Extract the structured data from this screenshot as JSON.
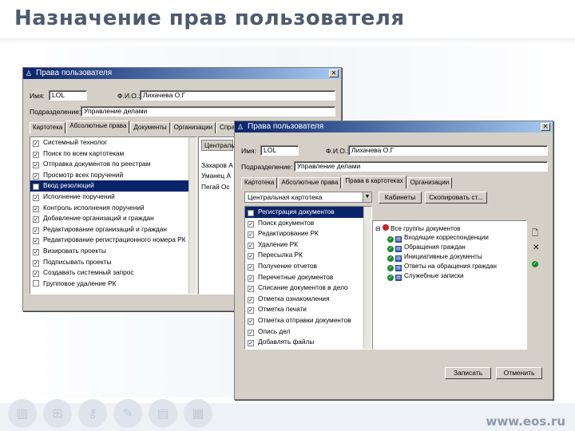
{
  "slide": {
    "title": "Назначение прав пользователя",
    "url": "www.eos.ru",
    "bottom_icons": [
      "folder-icon",
      "network-icon",
      "key-icon",
      "pen-icon",
      "clipboard-icon",
      "document-icon"
    ]
  },
  "back_window": {
    "title": "Права пользователя",
    "name_label": "Имя:",
    "name_value": "LOL",
    "fio_label": "Ф.И.О.:",
    "fio_value": "Лихачева О.Г",
    "dept_label": "Подразделение:",
    "dept_value": "Управление делами",
    "tabs": [
      "Картотека",
      "Абсолютные права",
      "Документы",
      "Организации",
      "Справочники"
    ],
    "permissions": [
      {
        "label": "Системный технолог",
        "checked": true,
        "selected": false
      },
      {
        "label": "Поиск по всем картотекам",
        "checked": true,
        "selected": false
      },
      {
        "label": "Отправка документов по реестрам",
        "checked": true,
        "selected": false
      },
      {
        "label": "Просмотр всех поручений",
        "checked": true,
        "selected": false
      },
      {
        "label": "Ввод резолюций",
        "checked": true,
        "selected": true
      },
      {
        "label": "Исполнение поручений",
        "checked": true,
        "selected": false
      },
      {
        "label": "Контроль исполнения поручений",
        "checked": true,
        "selected": false
      },
      {
        "label": "Добавление организаций и граждан",
        "checked": true,
        "selected": false
      },
      {
        "label": "Редактирование организаций и граждан",
        "checked": true,
        "selected": false
      },
      {
        "label": "Редактирование регистрационного номера РК",
        "checked": true,
        "selected": false
      },
      {
        "label": "Визировать проекты",
        "checked": true,
        "selected": false
      },
      {
        "label": "Подписывать проекты",
        "checked": true,
        "selected": false
      },
      {
        "label": "Создавать системный запрос",
        "checked": true,
        "selected": false
      },
      {
        "label": "Групповое удаление РК",
        "checked": false,
        "selected": false
      }
    ],
    "side_list_header": "Центральная",
    "side_list_items": [
      "Захаров А",
      "Уманец А",
      "Пегай Ос"
    ]
  },
  "front_window": {
    "title": "Права пользователя",
    "name_label": "Имя:",
    "name_value": "LOL",
    "fio_label": "Ф.И.О.:",
    "fio_value": "Лихачева О.Г",
    "dept_label": "Подразделение:",
    "dept_value": "Управление делами",
    "tabs": [
      "Картотека",
      "Абсолютные права",
      "Права в картотеках",
      "Организации"
    ],
    "cabinet_combo": "Центральная картотека",
    "btn_cabinets": "Кабинеты",
    "btn_copy": "Скопировать ст...",
    "permissions": [
      {
        "label": "Регистрация документов",
        "checked": true,
        "selected": true
      },
      {
        "label": "Поиск документов",
        "checked": true,
        "selected": false
      },
      {
        "label": "Редактирование РК",
        "checked": true,
        "selected": false
      },
      {
        "label": "Удаление РК",
        "checked": true,
        "selected": false
      },
      {
        "label": "Пересылка РК",
        "checked": true,
        "selected": false
      },
      {
        "label": "Получение отчетов",
        "checked": true,
        "selected": false
      },
      {
        "label": "Перечетные документов",
        "checked": true,
        "selected": false
      },
      {
        "label": "Списание документов в дело",
        "checked": true,
        "selected": false
      },
      {
        "label": "Отметка ознакомления",
        "checked": true,
        "selected": false
      },
      {
        "label": "Отметка печати",
        "checked": true,
        "selected": false
      },
      {
        "label": "Отметка отправки документов",
        "checked": true,
        "selected": false
      },
      {
        "label": "Опись дел",
        "checked": true,
        "selected": false
      },
      {
        "label": "Добавлять файлы",
        "checked": true,
        "selected": false
      }
    ],
    "tree_root": "Все группы документов",
    "tree_items": [
      "Входящие корреспонденции",
      "Обращения граждан",
      "Инициативные документы",
      "Ответы на обращения граждан",
      "Служебные записки"
    ],
    "btn_save": "Записать",
    "btn_cancel": "Отменить"
  }
}
